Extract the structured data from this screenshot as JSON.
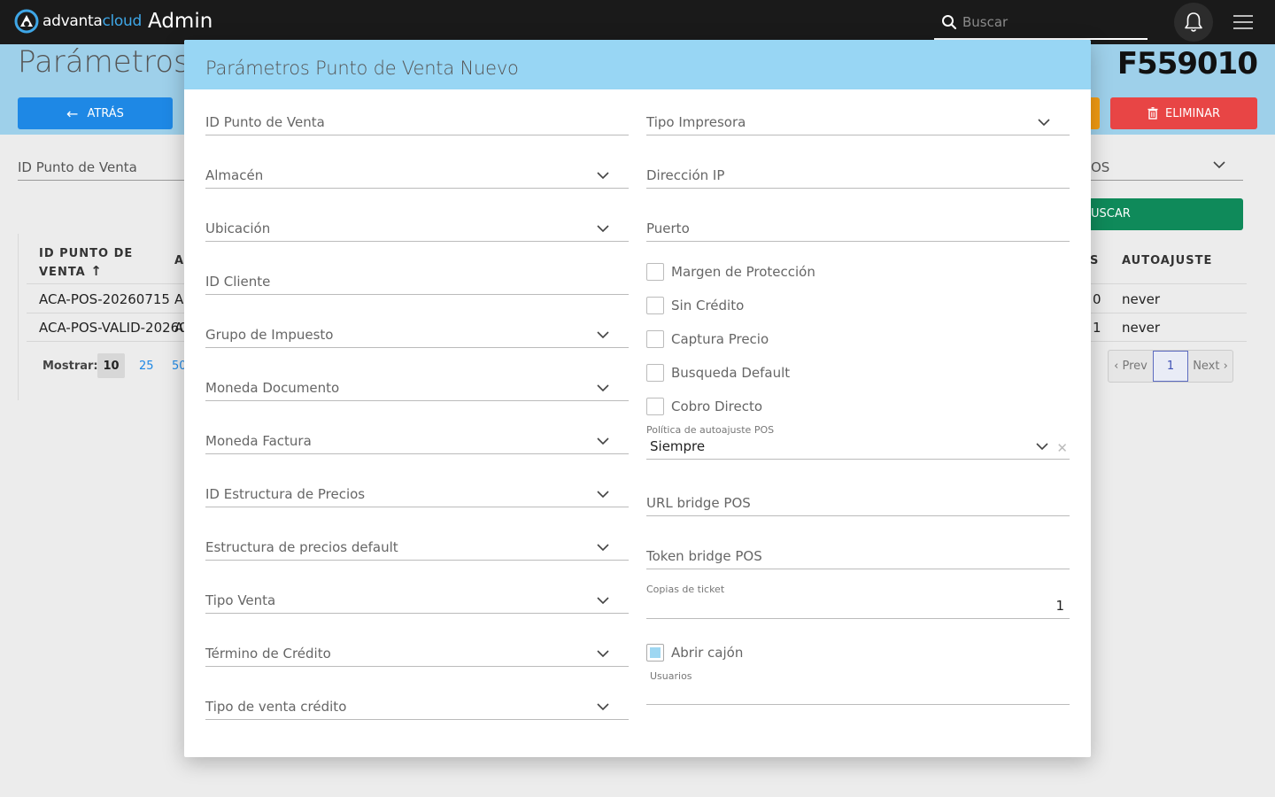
{
  "topbar": {
    "logo_text_a": "advanta",
    "logo_text_b": "cloud",
    "app_title": "Admin",
    "search_placeholder": "Buscar"
  },
  "page": {
    "title": "Parámetros P",
    "record_id": "F559010",
    "back_label": "ATRÁS",
    "delete_label": "ELIMINAR",
    "filter_left_label": "ID Punto de Venta",
    "filter_right_label": "OS",
    "search_button_label": "USCAR"
  },
  "table": {
    "col_id_line1": "ID PUNTO DE",
    "col_id_line2": "VENTA",
    "col_second": "AI",
    "col_partial": "S",
    "col_autoajuste": "AUTOAJUSTE",
    "rows": [
      {
        "id": "ACA-POS-20260715",
        "second": "AI",
        "num": "0",
        "autoajuste": "never"
      },
      {
        "id": "ACA-POS-VALID-202607",
        "second": "A",
        "num": "1",
        "autoajuste": "never"
      }
    ],
    "show_label": "Mostrar:",
    "page_sizes": [
      "10",
      "25",
      "50"
    ],
    "prev_label": "‹ Prev",
    "current_page": "1",
    "next_label": "Next ›"
  },
  "modal": {
    "title": "Parámetros Punto de Venta Nuevo",
    "left_fields": [
      {
        "label": "ID Punto de Venta",
        "dropdown": false
      },
      {
        "label": "Almacén",
        "dropdown": true
      },
      {
        "label": "Ubicación",
        "dropdown": true
      },
      {
        "label": "ID Cliente",
        "dropdown": false
      },
      {
        "label": "Grupo de Impuesto",
        "dropdown": true
      },
      {
        "label": "Moneda Documento",
        "dropdown": true
      },
      {
        "label": "Moneda Factura",
        "dropdown": true
      },
      {
        "label": "ID Estructura de Precios",
        "dropdown": true
      },
      {
        "label": "Estructura de precios default",
        "dropdown": true
      },
      {
        "label": "Tipo Venta",
        "dropdown": true
      },
      {
        "label": "Término de Crédito",
        "dropdown": true
      },
      {
        "label": "Tipo de venta crédito",
        "dropdown": true
      }
    ],
    "right_fields": {
      "printer_type": "Tipo Impresora",
      "ip_address": "Dirección IP",
      "port": "Puerto"
    },
    "checkboxes": [
      {
        "label": "Margen de Protección",
        "checked": false
      },
      {
        "label": "Sin Crédito",
        "checked": false
      },
      {
        "label": "Captura Precio",
        "checked": false
      },
      {
        "label": "Busqueda Default",
        "checked": false
      },
      {
        "label": "Cobro Directo",
        "checked": false
      }
    ],
    "autoadjust_policy": {
      "label": "Política de autoajuste POS",
      "value": "Siempre"
    },
    "bridge_url_label": "URL bridge POS",
    "bridge_token_label": "Token bridge POS",
    "ticket_copies": {
      "label": "Copias de ticket",
      "value": "1"
    },
    "open_drawer": {
      "label": "Abrir cajón",
      "checked": true
    },
    "users_label": "Usuarios"
  },
  "colors": {
    "topbar": "#1a1a1a",
    "modal_header": "#98d6f4",
    "primary": "#1e88e5",
    "danger": "#e84545",
    "success": "#0f8a5a",
    "warning": "#f39c12"
  }
}
